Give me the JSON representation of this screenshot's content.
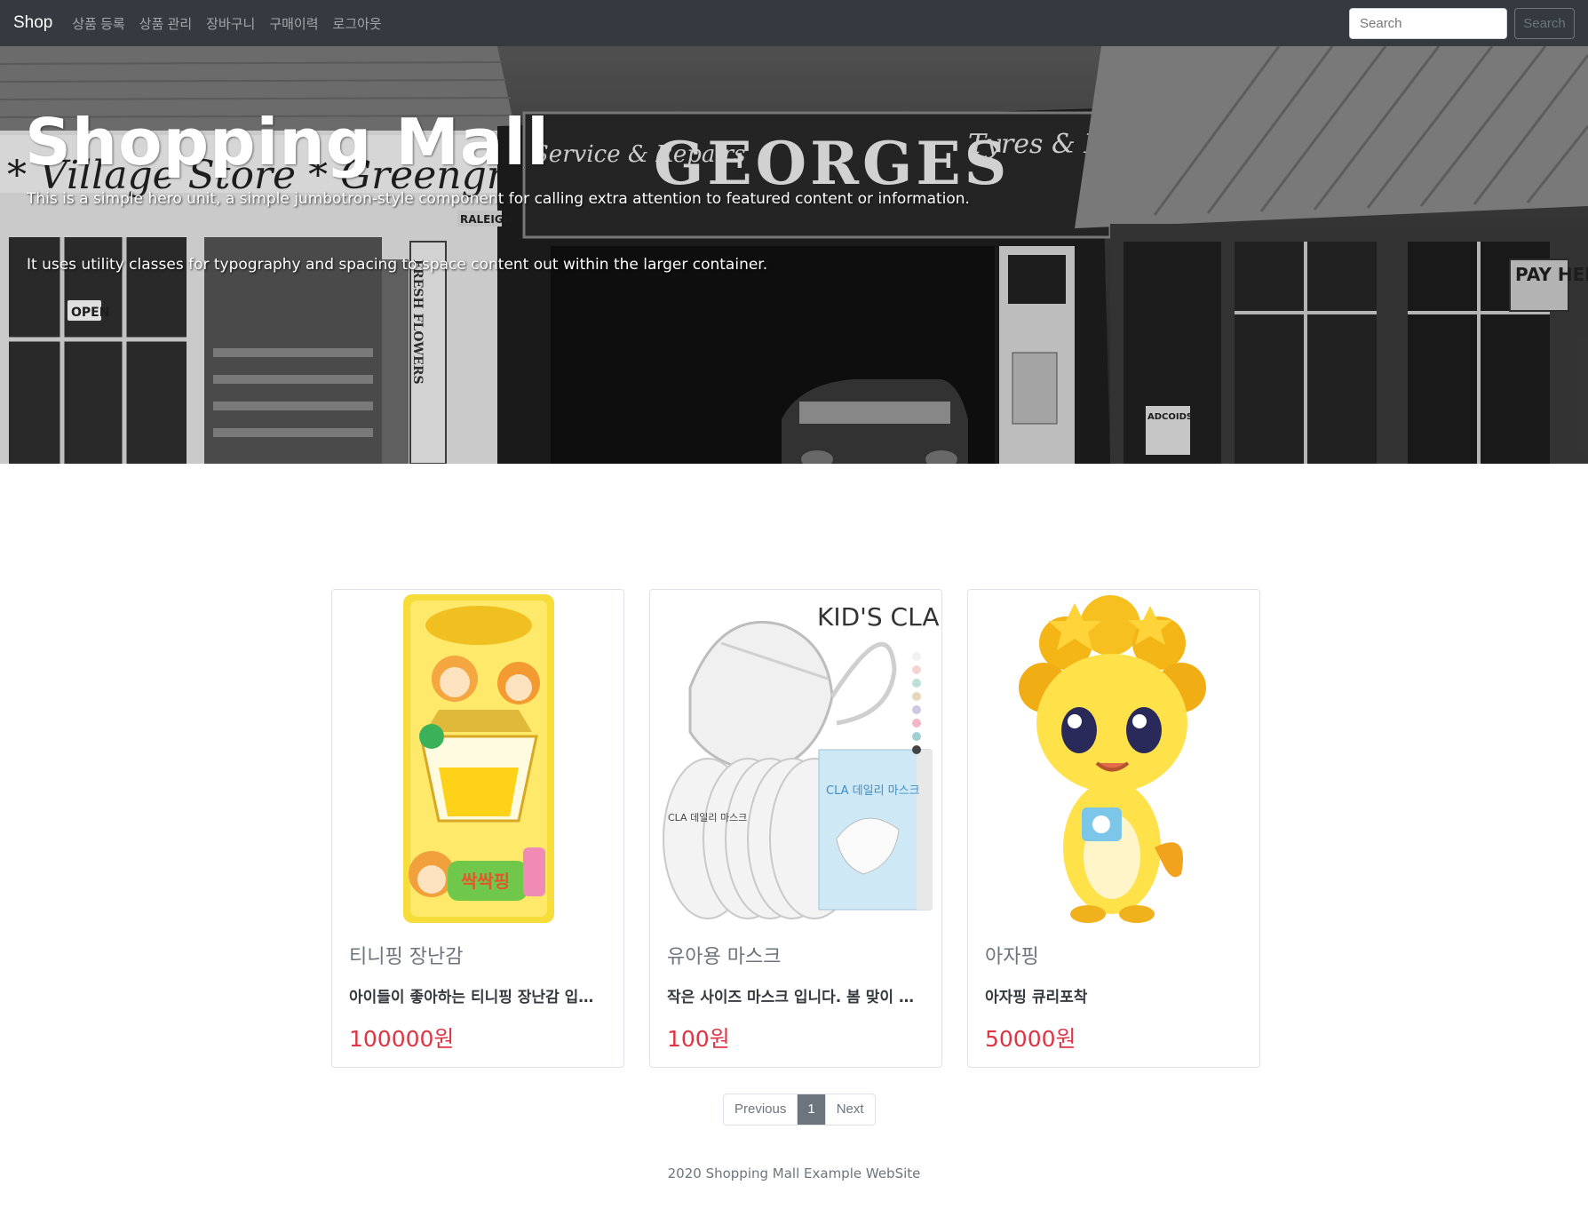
{
  "navbar": {
    "brand": "Shop",
    "links": [
      "상품 등록",
      "상품 관리",
      "장바구니",
      "구매이력",
      "로그아웃"
    ],
    "search_placeholder": "Search",
    "search_button": "Search"
  },
  "hero": {
    "title": "Shopping Mall",
    "lead1": "This is a simple hero unit, a simple jumbotron-style component for calling extra attention to featured content or information.",
    "lead2": "It uses utility classes for typography and spacing to space content out within the larger container.",
    "signs": {
      "village": "* Village Store * Greengrocer",
      "service": "Service & Repairs",
      "georges": "GEORGES",
      "tyres": "Tyres & Exhausts",
      "open": "OPEN",
      "pay": "PAY HERE",
      "flowers": "FRESH FLOWERS",
      "raleigh": "RALEIGH",
      "adcoids": "ADCOIDS"
    }
  },
  "products": [
    {
      "name": "티니핑 장난감",
      "description": "아이들이 좋아하는 티니핑 장난감 입니다.",
      "price": "100000원",
      "image": "toy-package"
    },
    {
      "name": "유아용 마스크",
      "description": "작은 사이즈 마스크 입니다. 봄 맞이 특가",
      "price": "100원",
      "image": "kids-mask",
      "brand_text": "KID'S CLA",
      "box_text": "CLA 데일리 마스크"
    },
    {
      "name": "아자핑",
      "description": "아자핑 큐리포착",
      "price": "50000원",
      "image": "yellow-character"
    }
  ],
  "pagination": {
    "previous": "Previous",
    "current": "1",
    "next": "Next"
  },
  "footer": {
    "text": "2020 Shopping Mall Example WebSite"
  }
}
